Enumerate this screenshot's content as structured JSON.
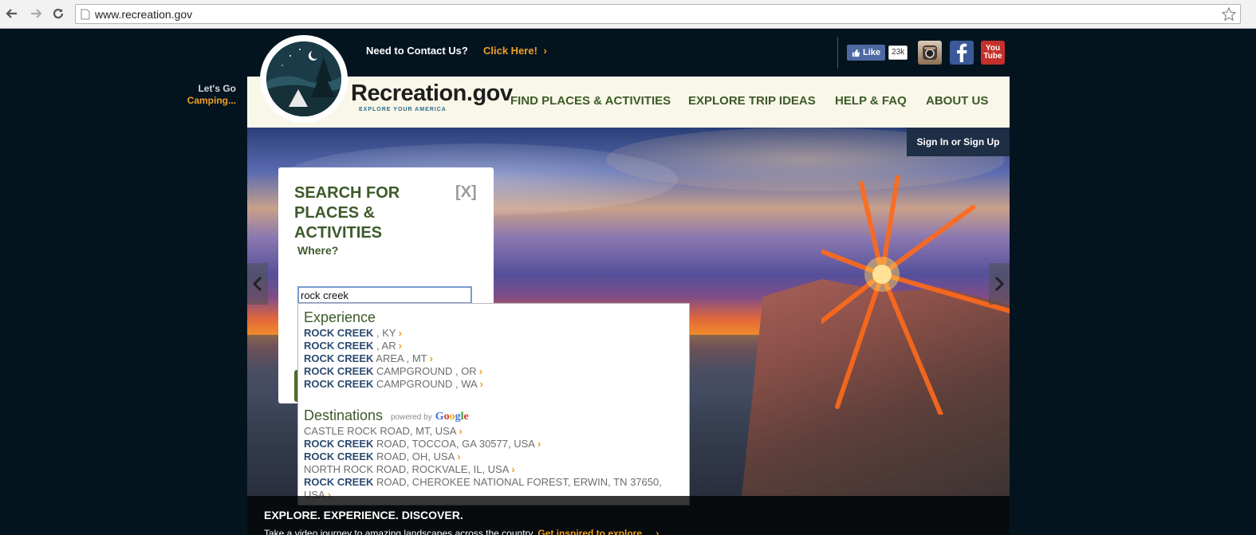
{
  "browser": {
    "url": "www.recreation.gov"
  },
  "header": {
    "contact_text": "Need to Contact Us?",
    "contact_link": "Click Here!",
    "contact_chevron": "›",
    "fb_like": "Like",
    "fb_count": "23k",
    "youtube_top": "You",
    "youtube_bottom": "Tube",
    "lets_go": "Let's Go",
    "lets_go_activity": "Camping...",
    "brand": "Recreation.gov",
    "tagline": "EXPLORE YOUR AMERICA",
    "nav": [
      "FIND PLACES & ACTIVITIES",
      "EXPLORE TRIP IDEAS",
      "HELP & FAQ",
      "ABOUT US"
    ],
    "sign_in": "Sign In or Sign Up"
  },
  "search": {
    "title_line1": "SEARCH FOR",
    "title_line2": "PLACES & ACTIVITIES",
    "close": "[X]",
    "where_label": "Where?",
    "where_value": "rock creek"
  },
  "dropdown": {
    "experience_heading": "Experience",
    "experience_items": [
      {
        "bold": "ROCK CREEK",
        "rest": " , KY"
      },
      {
        "bold": "ROCK CREEK",
        "rest": " , AR"
      },
      {
        "bold": "ROCK CREEK",
        "rest": " AREA , MT"
      },
      {
        "bold": "ROCK CREEK",
        "rest": " CAMPGROUND , OR"
      },
      {
        "bold": "ROCK CREEK",
        "rest": " CAMPGROUND , WA"
      }
    ],
    "destinations_heading": "Destinations",
    "powered_by": "powered by",
    "google": "Google",
    "destination_items": [
      {
        "pre": "CASTLE ROCK ROAD, MT, USA",
        "bold": "",
        "rest": ""
      },
      {
        "pre": "",
        "bold": "ROCK CREEK",
        "rest": " ROAD, TOCCOA, GA 30577, USA"
      },
      {
        "pre": "",
        "bold": "ROCK CREEK",
        "rest": " ROAD, OH, USA"
      },
      {
        "pre": "NORTH ROCK ROAD, ROCKVALE, IL, USA",
        "bold": "",
        "rest": ""
      },
      {
        "pre": "",
        "bold": "ROCK CREEK",
        "rest": " ROAD, CHEROKEE NATIONAL FOREST, ERWIN, TN 37650,"
      }
    ],
    "destination_wrap": "USA",
    "chevron": "›"
  },
  "footer": {
    "title": "EXPLORE. EXPERIENCE. DISCOVER.",
    "text": "Take a video journey to amazing landscapes across the country.",
    "link": "Get inspired to explore...",
    "chevron": "›"
  }
}
